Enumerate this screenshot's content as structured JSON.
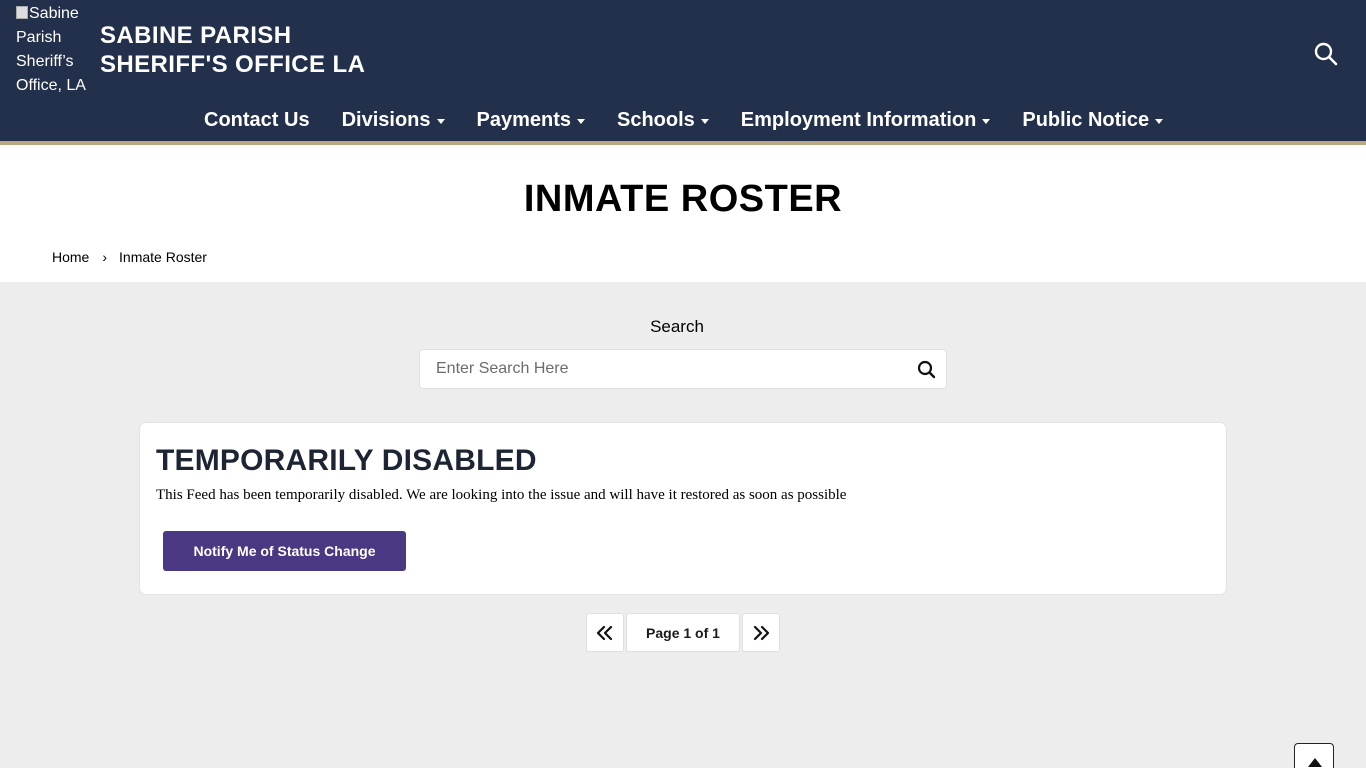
{
  "header": {
    "logo_alt": "Sabine Parish Sheriff’s Office, LA",
    "site_title_line1": "SABINE PARISH",
    "site_title_line2": "SHERIFF'S OFFICE LA",
    "search_icon": "search-icon"
  },
  "nav": {
    "items": [
      {
        "label": "Contact Us",
        "dropdown": false
      },
      {
        "label": "Divisions",
        "dropdown": true
      },
      {
        "label": "Payments",
        "dropdown": true
      },
      {
        "label": "Schools",
        "dropdown": true
      },
      {
        "label": "Employment Information",
        "dropdown": true
      },
      {
        "label": "Public Notice",
        "dropdown": true
      }
    ]
  },
  "page": {
    "title": "INMATE ROSTER"
  },
  "breadcrumb": {
    "home": "Home",
    "separator": "›",
    "current": "Inmate Roster"
  },
  "search": {
    "label": "Search",
    "placeholder": "Enter Search Here",
    "value": ""
  },
  "notice": {
    "title": "TEMPORARILY DISABLED",
    "message": "This Feed has been temporarily disabled. We are looking into the issue and will have it restored as soon as possible",
    "button_label": "Notify Me of Status Change"
  },
  "pagination": {
    "label": "Page 1 of 1",
    "first_icon": "double-chevron-left-icon",
    "last_icon": "double-chevron-right-icon"
  },
  "back_to_top_icon": "arrow-up-icon",
  "colors": {
    "header_bg": "#22304b",
    "header_accent": "#b8a886",
    "button_purple": "#4a3882",
    "page_bg": "#ededed"
  }
}
